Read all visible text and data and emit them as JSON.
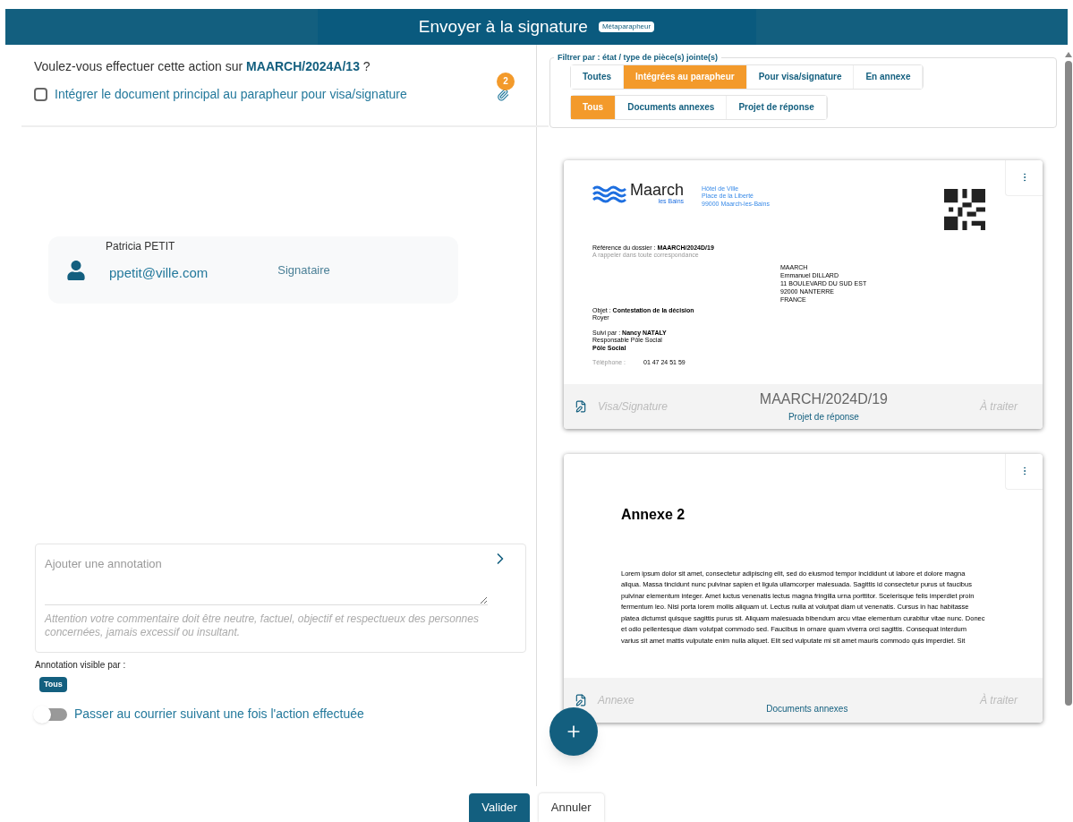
{
  "header": {
    "title": "Envoyer à la signature",
    "badge": "Métaparapheur"
  },
  "question": "Voulez-vous effectuer cette action sur **MAARCH/2024A/13** ?",
  "integrate": {
    "label": "Intégrer le document principal au parapheur pour visa/signature",
    "checked": false
  },
  "attachments_count": "2",
  "signatory": {
    "name": "Patricia PETIT",
    "email": "ppetit@ville.com",
    "role": "Signataire"
  },
  "annotation": {
    "placeholder": "Ajouter une annotation",
    "warning": "Attention votre commentaire doit être neutre, factuel, objectif et respectueux des personnes concernées, jamais excessif ou insultant."
  },
  "visibility": {
    "label": "Annotation visible par :",
    "chips": [
      "Tous"
    ]
  },
  "next_toggle": {
    "label": "Passer au courrier suivant une fois l'action effectuée",
    "on": false
  },
  "filter": {
    "legend": "Filtrer par : état / type de pièce(s) jointe(s)",
    "rows": [
      [
        {
          "label": "Toutes",
          "selected": false
        },
        {
          "label": "Intégrées au parapheur",
          "selected": true
        },
        {
          "label": "Pour visa/signature",
          "selected": false
        },
        {
          "label": "En annexe",
          "selected": false
        }
      ],
      [
        {
          "label": "Tous",
          "selected": true
        },
        {
          "label": "Documents annexes",
          "selected": false
        },
        {
          "label": "Projet de réponse",
          "selected": false
        }
      ]
    ]
  },
  "documents": [
    {
      "kind": "letter",
      "preview": {
        "logo_text": "Maarch",
        "logo_sub": "les Bains",
        "address": [
          "Hôtel de Ville",
          "Place de la Liberté",
          "99000 Maarch-les-Bains"
        ],
        "reference_label": "Référence du dossier : ",
        "reference": "MAARCH/2024D/19",
        "reference_note": "A rappeler dans toute correspondance",
        "recipient": [
          "MAARCH",
          "Emmanuel DILLARD",
          "11 BOULEVARD DU SUD EST",
          "92000 NANTERRE",
          "FRANCE"
        ],
        "object_label": "Objet : ",
        "object": "Contestation de la décision",
        "object_line2": "Royer",
        "followed_label": "Suivi par : ",
        "followed": "Nancy NATALY",
        "followed_role": "Responsable Pôle Social",
        "followed_dept": "Pôle Social",
        "phone_label": "Téléphone :",
        "phone": "01 47 24 51 59"
      },
      "type": "Visa/Signature",
      "reference": "MAARCH/2024D/19",
      "status": "À traiter",
      "category": "Projet de réponse"
    },
    {
      "kind": "annex",
      "preview": {
        "heading": "Annexe 2",
        "body": "Lorem ipsum dolor sit amet, consectetur adipiscing elit, sed do eiusmod tempor incididunt ut labore et dolore magna aliqua. Massa tincidunt nunc pulvinar sapien et ligula ullamcorper malesuada. Sagittis id consectetur purus ut faucibus pulvinar elementum integer. Amet luctus venenatis lectus magna fringilla urna porttitor. Scelerisque felis imperdiet proin fermentum leo. Nisi porta lorem mollis aliquam ut. Lectus nulla at volutpat diam ut venenatis. Cursus in hac habitasse platea dictumst quisque sagittis purus sit. Aliquam malesuada bibendum arcu vitae elementum curabitur vitae nunc. Donec et odio pellentesque diam volutpat commodo sed. Faucibus in ornare quam viverra orci sagittis. Consequat interdum varius sit amet mattis vulputate enim nulla aliquet. Elit sed vulputate mi sit amet mauris commodo quis imperdiet. Sit"
      },
      "type": "Annexe",
      "status": "À traiter",
      "category": "Documents annexes"
    }
  ],
  "buttons": [
    {
      "label": "Valider",
      "kind": "primary"
    },
    {
      "label": "Annuler",
      "kind": "secondary"
    }
  ]
}
